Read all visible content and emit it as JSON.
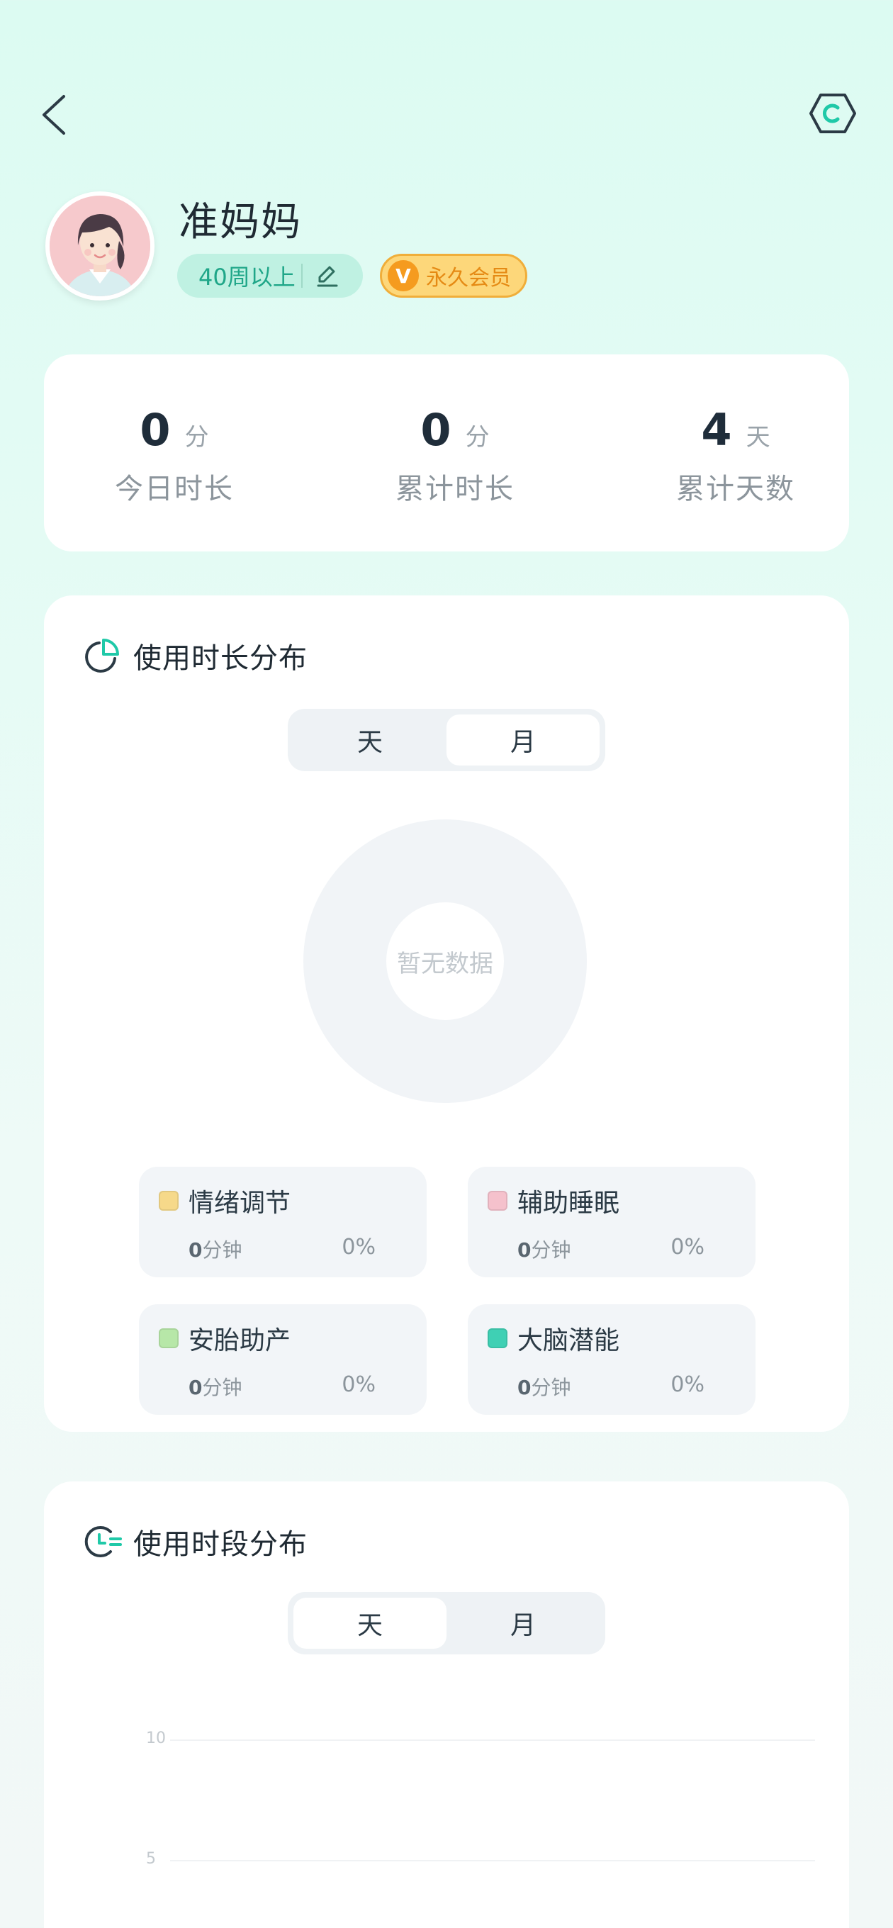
{
  "profile": {
    "name": "准妈妈",
    "week_label": "40周以上",
    "vip_label": "永久会员",
    "vip_mark": "V"
  },
  "stats": [
    {
      "value": "0",
      "unit": "分",
      "label": "今日时长"
    },
    {
      "value": "0",
      "unit": "分",
      "label": "累计时长"
    },
    {
      "value": "4",
      "unit": "天",
      "label": "累计天数"
    }
  ],
  "usage_distribution": {
    "title": "使用时长分布",
    "tabs": [
      {
        "label": "天",
        "active": false
      },
      {
        "label": "月",
        "active": true
      }
    ],
    "empty_text": "暂无数据",
    "legend": [
      {
        "name": "情绪调节",
        "minutes": "0",
        "minute_unit": "分钟",
        "percent": "0%",
        "color": "#f6d98a"
      },
      {
        "name": "辅助睡眠",
        "minutes": "0",
        "minute_unit": "分钟",
        "percent": "0%",
        "color": "#f5c1cc"
      },
      {
        "name": "安胎助产",
        "minutes": "0",
        "minute_unit": "分钟",
        "percent": "0%",
        "color": "#b7e7a8"
      },
      {
        "name": "大脑潜能",
        "minutes": "0",
        "minute_unit": "分钟",
        "percent": "0%",
        "color": "#3fd0b4"
      }
    ]
  },
  "period_distribution": {
    "title": "使用时段分布",
    "tabs": [
      {
        "label": "天",
        "active": true
      },
      {
        "label": "月",
        "active": false
      }
    ],
    "y_ticks": [
      "10",
      "5"
    ]
  },
  "colors": {
    "accent": "#1fa688",
    "vip": "#f0ae3a",
    "title_icon": "#2b3a45"
  },
  "icons": {
    "back": "back-arrow-icon",
    "settings": "hexagon-refresh-icon",
    "usage_title": "pie-chart-icon",
    "period_title": "clock-list-icon",
    "edit": "pencil-icon"
  }
}
